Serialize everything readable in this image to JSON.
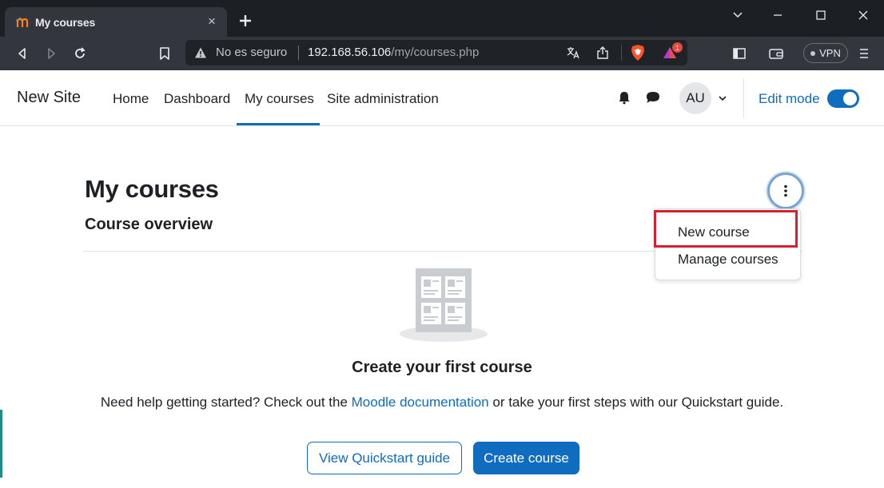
{
  "browser": {
    "tab_title": "My courses",
    "tab_close": "×",
    "new_tab": "+",
    "omnibox": {
      "security_text": "No es seguro",
      "url_host": "192.168.56.106",
      "url_path": "/my/courses.php"
    },
    "brave_badge_count": "1",
    "vpn_label": "VPN"
  },
  "navbar": {
    "site_name": "New Site",
    "items": [
      {
        "label": "Home"
      },
      {
        "label": "Dashboard"
      },
      {
        "label": "My courses",
        "active": true
      },
      {
        "label": "Site administration"
      }
    ],
    "avatar_initials": "AU",
    "edit_mode_label": "Edit mode",
    "edit_mode_on": true
  },
  "main": {
    "page_title": "My courses",
    "section_title": "Course overview",
    "actions_menu": {
      "items": [
        {
          "label": "New course",
          "highlighted": true
        },
        {
          "label": "Manage courses"
        }
      ]
    },
    "empty_state": {
      "title": "Create your first course",
      "text_before": "Need help getting started? Check out the ",
      "link_text": "Moodle documentation",
      "text_after": " or take your first steps with our Quickstart guide.",
      "button_quickstart": "View Quickstart guide",
      "button_create": "Create course"
    }
  },
  "colors": {
    "brand_blue": "#0f6cbf",
    "highlight_red": "#d62032",
    "chrome_dark": "#1c1f24"
  }
}
